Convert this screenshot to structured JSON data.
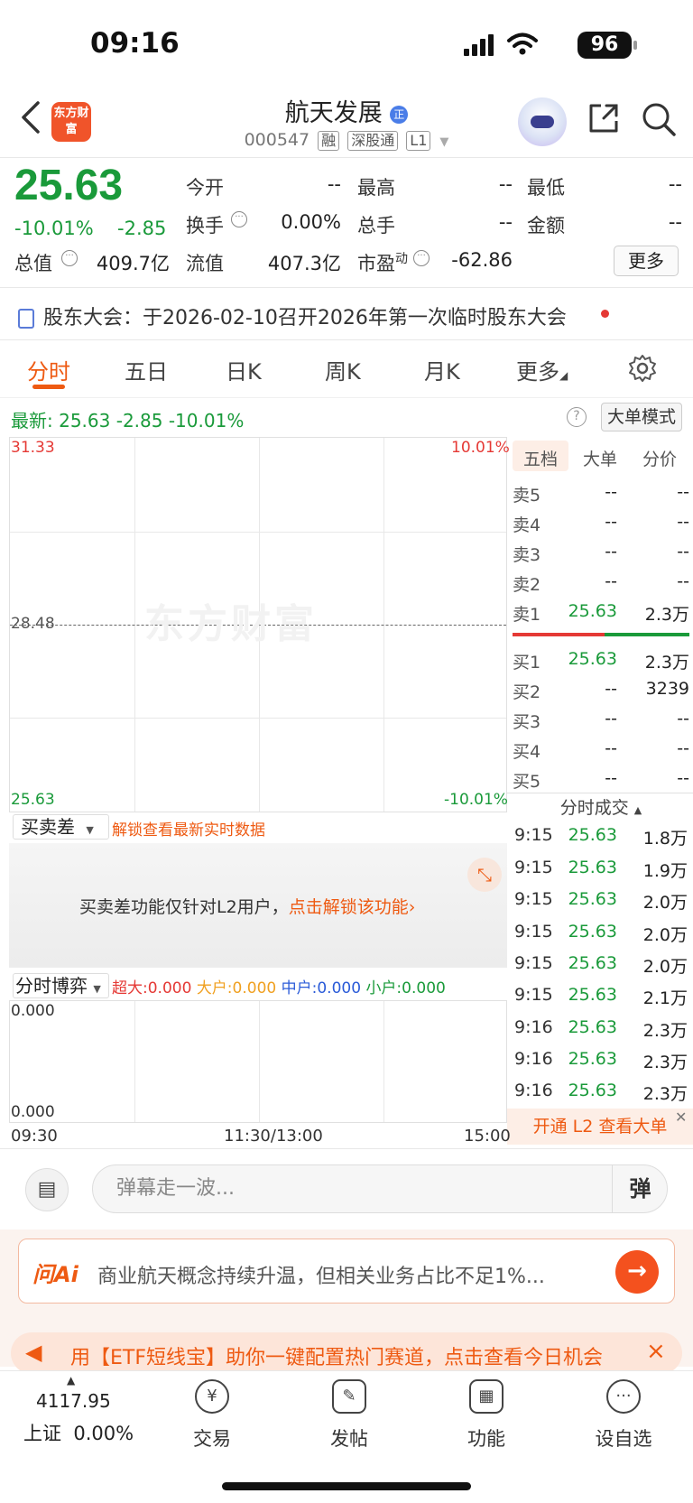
{
  "status": {
    "time": "09:16",
    "battery": "96"
  },
  "header": {
    "logo": "东方财富",
    "stock_name": "航天发展",
    "badge": "正",
    "code": "000547",
    "tags": [
      "融",
      "深股通",
      "L1"
    ]
  },
  "quote": {
    "price": "25.63",
    "change_pct": "-10.01%",
    "change": "-2.85",
    "open_label": "今开",
    "open": "--",
    "high_label": "最高",
    "high": "--",
    "low_label": "最低",
    "low": "--",
    "turnover_label": "换手",
    "turnover": "0.00%",
    "volume_label": "总手",
    "volume": "--",
    "amount_label": "金额",
    "amount": "--",
    "mktcap_label": "总值",
    "mktcap": "409.7亿",
    "float_label": "流值",
    "float": "407.3亿",
    "pe_label": "市盈",
    "pe_sup": "动",
    "pe": "-62.86",
    "more": "更多"
  },
  "notice": "股东大会：于2026-02-10召开2026年第一次临时股东大会",
  "tabs": [
    "分时",
    "五日",
    "日K",
    "周K",
    "月K",
    "更多"
  ],
  "latest": {
    "label": "最新:",
    "price": "25.63",
    "change": "-2.85",
    "pct": "-10.01%",
    "bigorder": "大单模式"
  },
  "chart": {
    "y_top": "31.33",
    "y_mid": "28.48",
    "y_bottom": "25.63",
    "pct_top": "10.01%",
    "pct_bottom": "-10.01%",
    "watermark": "东方财富"
  },
  "orderbook": {
    "tabs": [
      "五档",
      "大单",
      "分价"
    ],
    "asks": [
      {
        "label": "卖5",
        "price": "--",
        "vol": "--"
      },
      {
        "label": "卖4",
        "price": "--",
        "vol": "--"
      },
      {
        "label": "卖3",
        "price": "--",
        "vol": "--"
      },
      {
        "label": "卖2",
        "price": "--",
        "vol": "--"
      },
      {
        "label": "卖1",
        "price": "25.63",
        "vol": "2.3万"
      }
    ],
    "bids": [
      {
        "label": "买1",
        "price": "25.63",
        "vol": "2.3万"
      },
      {
        "label": "买2",
        "price": "--",
        "vol": "3239"
      },
      {
        "label": "买3",
        "price": "--",
        "vol": "--"
      },
      {
        "label": "买4",
        "price": "--",
        "vol": "--"
      },
      {
        "label": "买5",
        "price": "--",
        "vol": "--"
      }
    ]
  },
  "ticks": {
    "header": "分时成交",
    "rows": [
      {
        "t": "9:15",
        "p": "25.63",
        "v": "1.8万"
      },
      {
        "t": "9:15",
        "p": "25.63",
        "v": "1.9万"
      },
      {
        "t": "9:15",
        "p": "25.63",
        "v": "2.0万"
      },
      {
        "t": "9:15",
        "p": "25.63",
        "v": "2.0万"
      },
      {
        "t": "9:15",
        "p": "25.63",
        "v": "2.0万"
      },
      {
        "t": "9:15",
        "p": "25.63",
        "v": "2.1万"
      },
      {
        "t": "9:16",
        "p": "25.63",
        "v": "2.3万"
      },
      {
        "t": "9:16",
        "p": "25.63",
        "v": "2.3万"
      },
      {
        "t": "9:16",
        "p": "25.63",
        "v": "2.3万"
      }
    ],
    "l2_banner": "开通 L2 查看大单"
  },
  "spread": {
    "select": "买卖差",
    "unlock": "解锁查看最新实时数据",
    "lock_text": "买卖差功能仅针对L2用户，",
    "lock_link": "点击解锁该功能"
  },
  "game": {
    "select": "分时博弈",
    "super": "超大:0.000",
    "large": "大户:0.000",
    "mid": "中户:0.000",
    "small": "小户:0.000",
    "y_top": "0.000",
    "y_bottom": "0.000"
  },
  "time_axis": {
    "start": "09:30",
    "mid": "11:30/13:00",
    "end": "15:00"
  },
  "comment": {
    "placeholder": "弹幕走一波...",
    "danmu": "弹"
  },
  "ai": {
    "logo": "问Ai",
    "text": "商业航天概念持续升温，但相关业务占比不足1%..."
  },
  "promo": {
    "text": "用【ETF短线宝】助你一键配置热门赛道，点击查看今日机会"
  },
  "bottom": {
    "index_value": "4117.95",
    "index_name": "上证",
    "index_pct": "0.00%",
    "items": [
      "交易",
      "发帖",
      "功能",
      "设自选"
    ]
  },
  "colors": {
    "up": "#e53935",
    "down": "#1a9a3a",
    "accent": "#ee5a12"
  }
}
